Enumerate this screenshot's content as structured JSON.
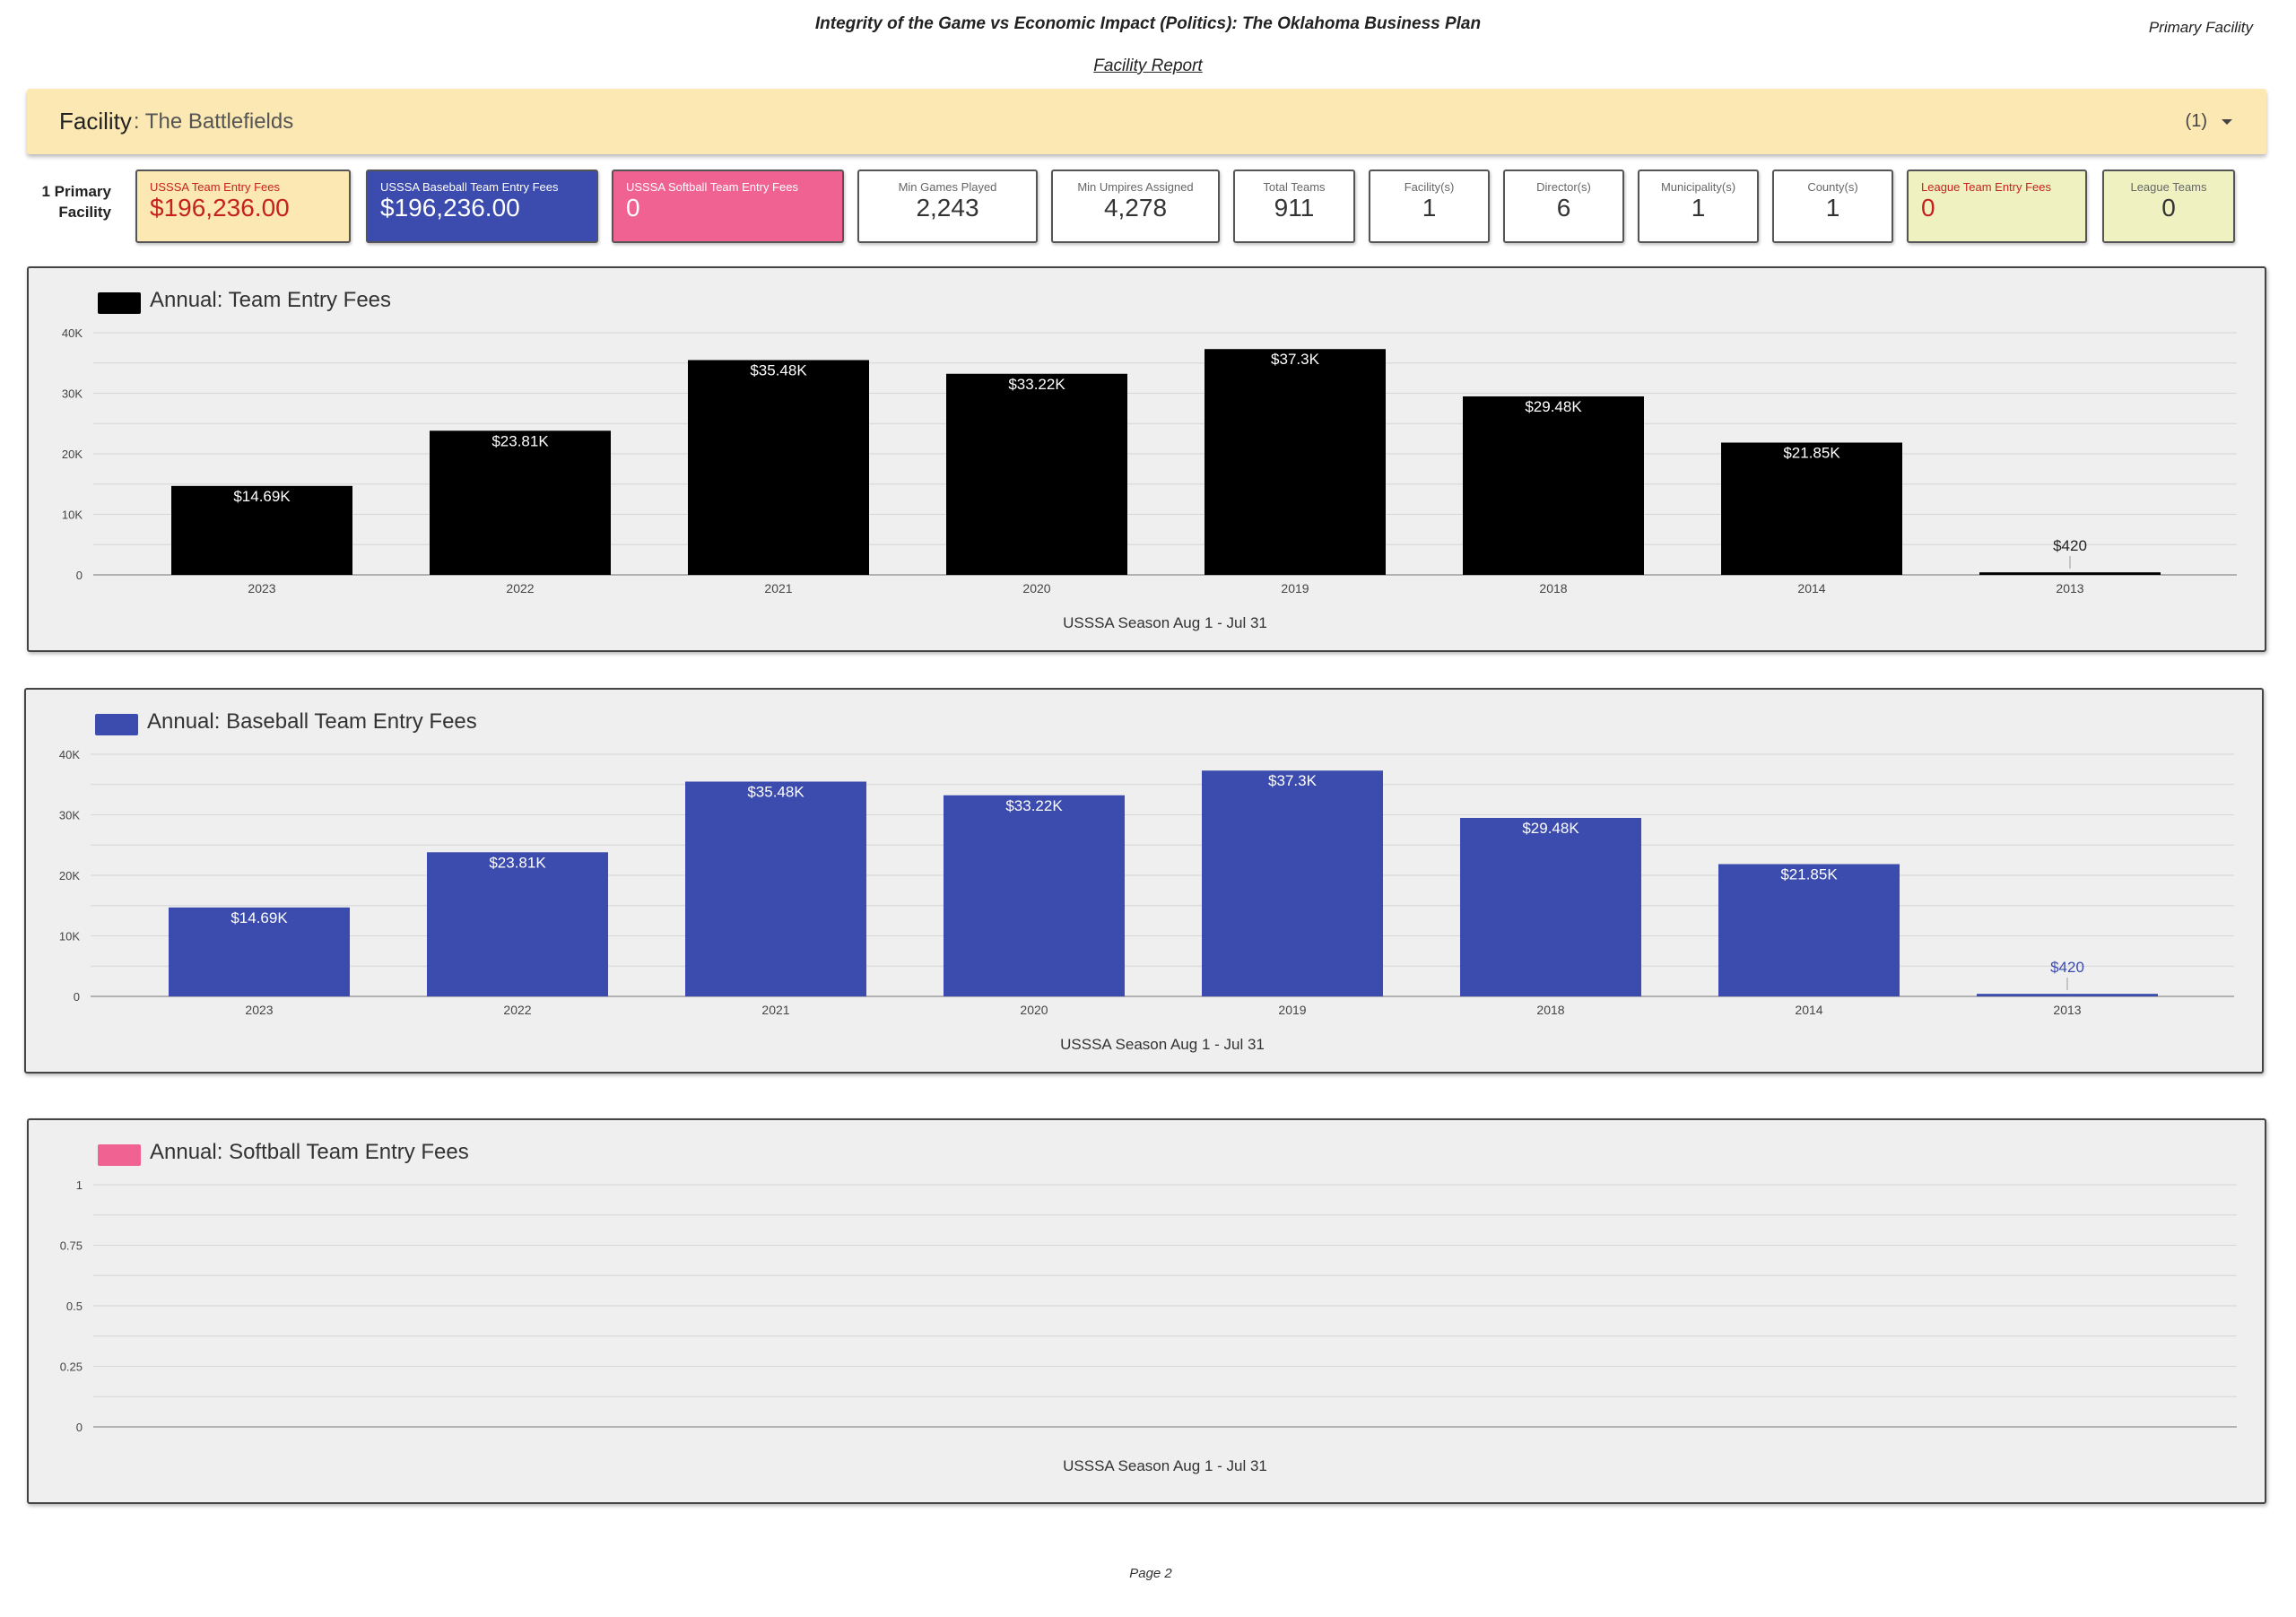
{
  "header": {
    "title": "Integrity of the Game vs Economic Impact (Politics): The Oklahoma Business Plan",
    "right_label": "Primary Facility",
    "subtitle": "Facility Report"
  },
  "facility_bar": {
    "label": "Facility",
    "value": ": The Battlefields",
    "count": "(1)"
  },
  "scorecard_label": "1 Primary Facility",
  "cards": [
    {
      "title": "USSSA Team Entry Fees",
      "value": "$196,236.00"
    },
    {
      "title": "USSSA Baseball Team Entry Fees",
      "value": "$196,236.00"
    },
    {
      "title": "USSSA Softball Team Entry Fees",
      "value": "0"
    },
    {
      "title": "Min Games Played",
      "value": "2,243"
    },
    {
      "title": "Min Umpires Assigned",
      "value": "4,278"
    },
    {
      "title": "Total Teams",
      "value": "911"
    },
    {
      "title": "Facility(s)",
      "value": "1"
    },
    {
      "title": "Director(s)",
      "value": "6"
    },
    {
      "title": "Municipality(s)",
      "value": "1"
    },
    {
      "title": "County(s)",
      "value": "1"
    },
    {
      "title": "League Team Entry Fees",
      "value": "0"
    },
    {
      "title": "League Teams",
      "value": "0"
    }
  ],
  "colors": {
    "total": "#000000",
    "baseball": "#3b4bae",
    "softball": "#f06292",
    "facility_bar": "#fce8b2",
    "card_yellow": "#fce8b2",
    "card_blue": "#3b4bae",
    "card_pink": "#f06292",
    "card_green": "#eff2c0",
    "red_text": "#c5221f"
  },
  "chart_data": [
    {
      "type": "bar",
      "title": "Annual: Team Entry Fees",
      "xlabel": "USSSA Season Aug 1 - Jul 31",
      "categories": [
        "2023",
        "2022",
        "2021",
        "2020",
        "2019",
        "2018",
        "2014",
        "2013"
      ],
      "values": [
        14690,
        23810,
        35480,
        33220,
        37300,
        29480,
        21850,
        420
      ],
      "data_labels": [
        "$14.69K",
        "$23.81K",
        "$35.48K",
        "$33.22K",
        "$37.3K",
        "$29.48K",
        "$21.85K",
        "$420"
      ],
      "ylim": [
        0,
        40000
      ],
      "yticks": [
        "0",
        "10K",
        "20K",
        "30K",
        "40K"
      ],
      "grid": true
    },
    {
      "type": "bar",
      "title": "Annual: Baseball Team Entry Fees",
      "xlabel": "USSSA Season Aug 1 - Jul 31",
      "categories": [
        "2023",
        "2022",
        "2021",
        "2020",
        "2019",
        "2018",
        "2014",
        "2013"
      ],
      "values": [
        14690,
        23810,
        35480,
        33220,
        37300,
        29480,
        21850,
        420
      ],
      "data_labels": [
        "$14.69K",
        "$23.81K",
        "$35.48K",
        "$33.22K",
        "$37.3K",
        "$29.48K",
        "$21.85K",
        "$420"
      ],
      "ylim": [
        0,
        40000
      ],
      "yticks": [
        "0",
        "10K",
        "20K",
        "30K",
        "40K"
      ],
      "grid": true
    },
    {
      "type": "bar",
      "title": "Annual: Softball Team Entry Fees",
      "xlabel": "USSSA Season Aug 1 - Jul 31",
      "categories": [],
      "values": [],
      "data_labels": [],
      "ylim": [
        0,
        1
      ],
      "yticks": [
        "0",
        "0.25",
        "0.5",
        "0.75",
        "1"
      ],
      "grid": true
    }
  ],
  "footer": {
    "page": "Page 2"
  }
}
